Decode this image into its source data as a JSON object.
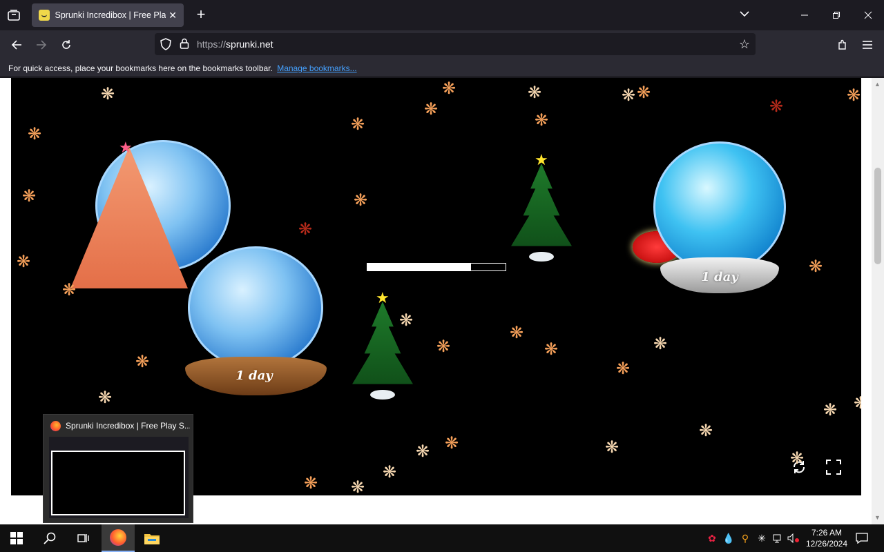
{
  "browser": {
    "tab_title": "Sprunki Incredibox | Free Play S",
    "new_tab_symbol": "+",
    "tab_close_symbol": "✕",
    "url_scheme": "https://",
    "url_host": "sprunki.net",
    "bookmarks_message": "For quick access, place your bookmarks here on the bookmarks toolbar.",
    "bookmarks_link": "Manage bookmarks..."
  },
  "game": {
    "progress_fraction": 0.75,
    "globe_left_label": "1 day",
    "globe_right_label": "1 day"
  },
  "preview": {
    "title": "Sprunki Incredibox | Free Play S..."
  },
  "taskbar": {
    "time": "7:26 AM",
    "date": "12/26/2024"
  },
  "colors": {
    "chrome_dark": "#1c1b22",
    "chrome_toolbar": "#2b2a33",
    "link": "#45a1ff",
    "flake_orange": "#f5a05a",
    "flake_light": "#f6d7b0",
    "flake_dark": "#b52a1a"
  },
  "icons": [
    "tab-overview-icon",
    "chevron-down-icon",
    "minimize-icon",
    "restore-icon",
    "close-icon",
    "back-icon",
    "forward-icon",
    "reload-icon",
    "shield-icon",
    "lock-icon",
    "bookmark-star-icon",
    "extensions-icon",
    "menu-icon",
    "rotate-icon",
    "fullscreen-icon",
    "windows-start-icon",
    "search-icon",
    "task-view-icon",
    "firefox-icon",
    "file-explorer-icon"
  ]
}
